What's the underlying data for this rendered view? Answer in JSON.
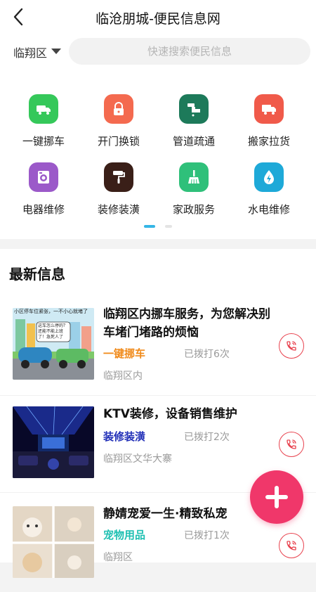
{
  "header": {
    "title": "临沧朋城-便民信息网"
  },
  "topbar": {
    "district": "临翔区",
    "search_placeholder": "快速搜索便民信息"
  },
  "services": [
    {
      "label": "一键挪车",
      "icon": "truck-icon",
      "color": "#35c85a"
    },
    {
      "label": "开门换锁",
      "icon": "lock-icon",
      "color": "#f46a4f"
    },
    {
      "label": "管道疏通",
      "icon": "pipe-faucet-icon",
      "color": "#1d7a5a"
    },
    {
      "label": "搬家拉货",
      "icon": "moving-truck-icon",
      "color": "#f05a4a"
    },
    {
      "label": "电器维修",
      "icon": "washing-machine-icon",
      "color": "#9b59c9"
    },
    {
      "label": "装修装潢",
      "icon": "paint-roller-icon",
      "color": "#3a1f18"
    },
    {
      "label": "家政服务",
      "icon": "broom-icon",
      "color": "#2fc07a"
    },
    {
      "label": "水电维修",
      "icon": "lightning-drop-icon",
      "color": "#1ea9d8"
    }
  ],
  "pager": {
    "active_color": "#35b6e6",
    "inactive_color": "#e4e4e4"
  },
  "news": {
    "heading": "最新信息",
    "items": [
      {
        "title": "临翔区内挪车服务，为您解决别车堵门堵路的烦恼",
        "category": "一键挪车",
        "category_color": "#f08a1a",
        "calls": "已拨打6次",
        "location": "临翔区内",
        "comic_caption": "小区停车位紧张，一不小心就堵了",
        "comic_bubble": "这车怎么停的？还能不能上班了！急死人了"
      },
      {
        "title": "KTV装修，设备销售维护",
        "category": "装修装潢",
        "category_color": "#2230b8",
        "calls": "已拨打2次",
        "location": "临翔区文华大寨"
      },
      {
        "title": "静婧宠爱一生·精致私宠",
        "category": "宠物用品",
        "category_color": "#1fc0b2",
        "calls": "已拨打1次",
        "location": "临翔区"
      }
    ]
  },
  "accent_red": "#e8434f",
  "fab_color": "#f0376a"
}
